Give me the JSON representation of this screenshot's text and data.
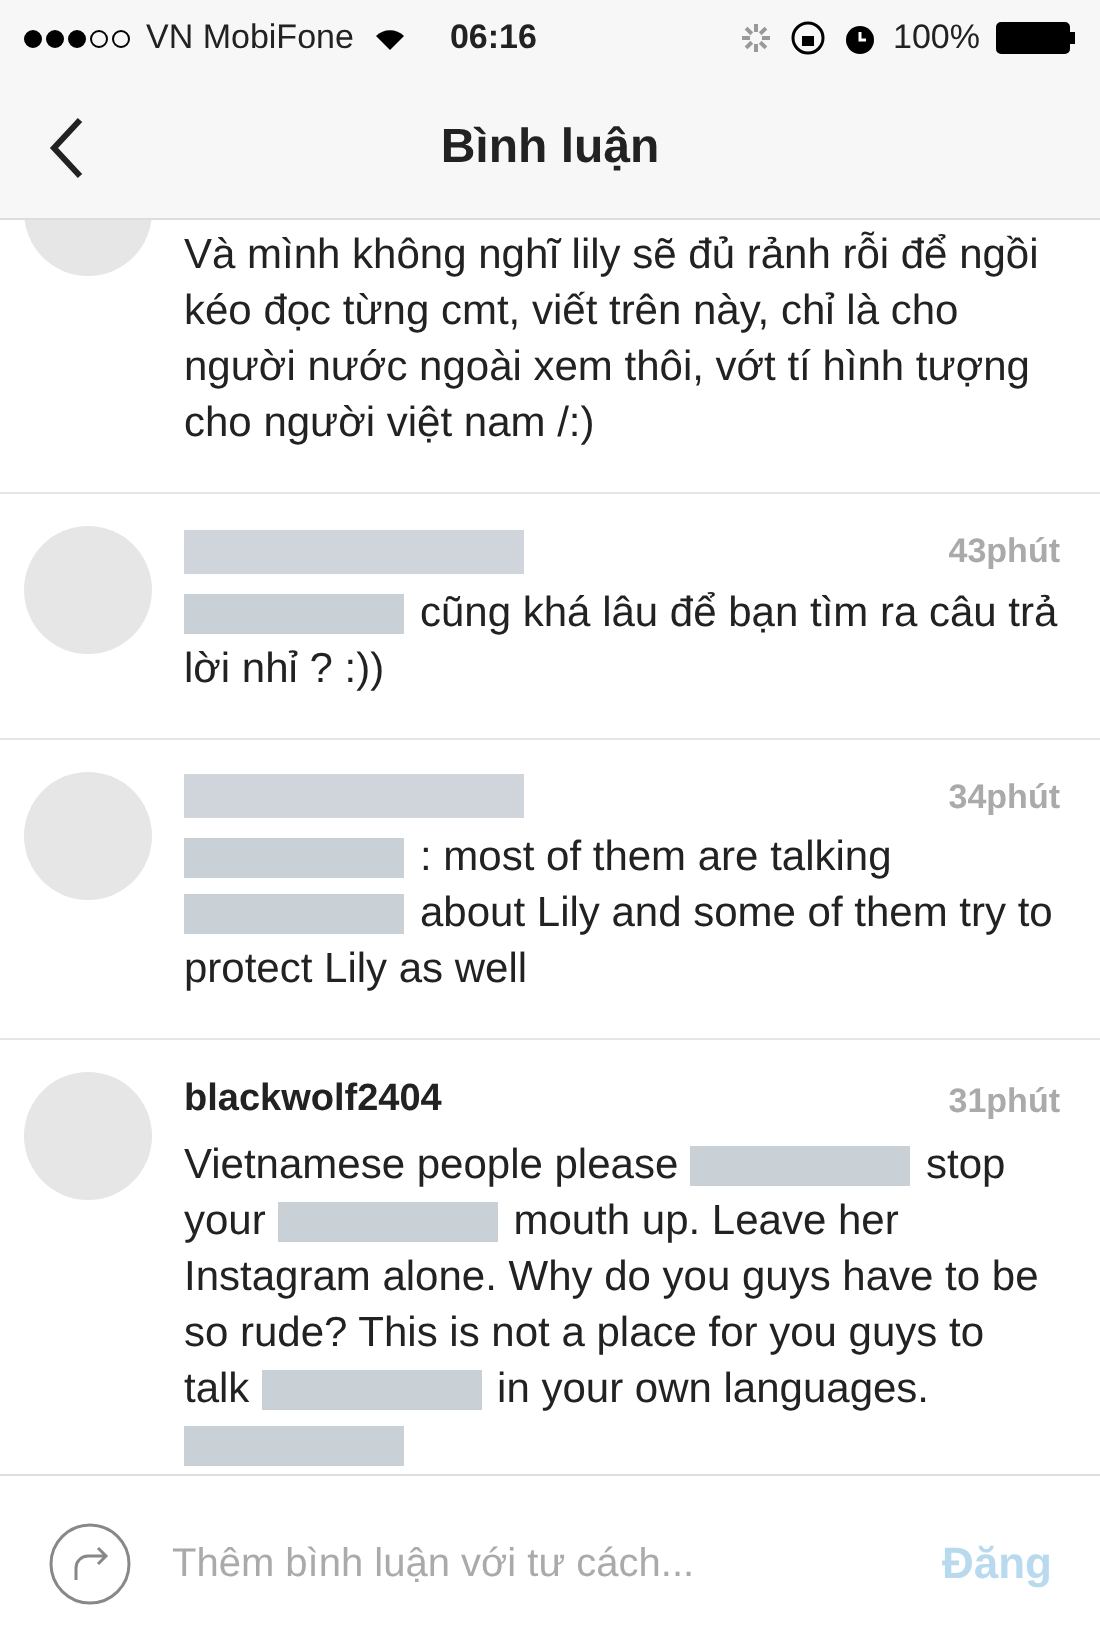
{
  "status_bar": {
    "carrier": "VN MobiFone",
    "time": "06:16",
    "battery": "100%"
  },
  "nav": {
    "title": "Bình luận"
  },
  "comments": [
    {
      "segments": [
        {
          "kind": "text",
          "text": "Và mình không nghĩ lily sẽ đủ rảnh rỗi để ngồi kéo đọc từng cmt, viết trên này, chỉ là cho người nước ngoài xem thôi, vớt tí hình tượng cho người việt nam /:)"
        }
      ]
    },
    {
      "username_redacted": true,
      "time": "43phút",
      "segments": [
        {
          "kind": "redacted"
        },
        {
          "kind": "text",
          "text": "cũng khá lâu để bạn tìm ra câu trả lời nhỉ ? :))"
        }
      ]
    },
    {
      "username_redacted": true,
      "time": "34phút",
      "segments": [
        {
          "kind": "redacted"
        },
        {
          "kind": "text",
          "text": ": most of them are talking"
        },
        {
          "kind": "redacted"
        },
        {
          "kind": "text",
          "text": "about Lily and some of them try to protect Lily as well"
        }
      ]
    },
    {
      "username": "blackwolf2404",
      "time": "31phút",
      "segments": [
        {
          "kind": "text",
          "text": "Vietnamese people please"
        },
        {
          "kind": "redacted"
        },
        {
          "kind": "text",
          "text": "stop your"
        },
        {
          "kind": "redacted"
        },
        {
          "kind": "text",
          "text": "mouth up. Leave her Instagram alone. Why do you guys have to be so rude? This is not a place for you guys to talk"
        },
        {
          "kind": "redacted"
        },
        {
          "kind": "text",
          "text": "in your own languages."
        },
        {
          "kind": "redacted"
        }
      ]
    }
  ],
  "composer": {
    "placeholder": "Thêm bình luận với tư cách...",
    "post_label": "Đăng"
  }
}
